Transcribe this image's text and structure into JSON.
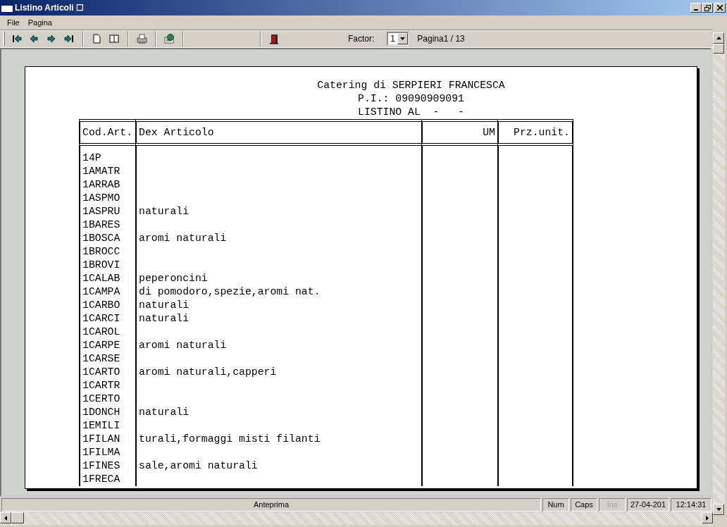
{
  "window": {
    "title": "Listino Articoli ☐"
  },
  "menu": [
    "File",
    "Pagina"
  ],
  "toolbar": {
    "buttons": [
      {
        "kind": "first"
      },
      {
        "kind": "prev"
      },
      {
        "kind": "next"
      },
      {
        "kind": "last"
      },
      {
        "kind": "sep"
      },
      {
        "kind": "page"
      },
      {
        "kind": "book"
      },
      {
        "kind": "sep"
      },
      {
        "kind": "print"
      },
      {
        "kind": "sep"
      },
      {
        "kind": "export"
      },
      {
        "kind": "sep"
      },
      {
        "kind": "spacer"
      },
      {
        "kind": "exit"
      }
    ],
    "factor_label": "Factor:",
    "factor_value": "1",
    "page_info": "Pagina1 / 13"
  },
  "report": {
    "header": [
      "Catering di SERPIERI FRANCESCA",
      "P.I.: 09090909091",
      "LISTINO AL  -   -"
    ],
    "columns": [
      "Cod.Art.",
      "Dex Articolo",
      "UM",
      "Prz.unit."
    ],
    "rows": [
      {
        "code": "14P",
        "desc": ""
      },
      {
        "code": "1AMATR",
        "desc": ""
      },
      {
        "code": "1ARRAB",
        "desc": ""
      },
      {
        "code": "1ASPMO",
        "desc": ""
      },
      {
        "code": "1ASPRU",
        "desc": "naturali"
      },
      {
        "code": "1BARES",
        "desc": ""
      },
      {
        "code": "1BOSCA",
        "desc": "aromi naturali"
      },
      {
        "code": "1BROCC",
        "desc": ""
      },
      {
        "code": "1BROVI",
        "desc": ""
      },
      {
        "code": "1CALAB",
        "desc": "peperoncini"
      },
      {
        "code": "1CAMPA",
        "desc": "di pomodoro,spezie,aromi nat."
      },
      {
        "code": "1CARBO",
        "desc": "naturali"
      },
      {
        "code": "1CARCI",
        "desc": "naturali"
      },
      {
        "code": "1CAROL",
        "desc": ""
      },
      {
        "code": "1CARPE",
        "desc": "aromi naturali"
      },
      {
        "code": "1CARSE",
        "desc": ""
      },
      {
        "code": "1CARTO",
        "desc": "aromi naturali,capperi"
      },
      {
        "code": "1CARTR",
        "desc": ""
      },
      {
        "code": "1CERTO",
        "desc": ""
      },
      {
        "code": "1DONCH",
        "desc": "naturali"
      },
      {
        "code": "1EMILI",
        "desc": ""
      },
      {
        "code": "1FILAN",
        "desc": "turali,formaggi misti filanti"
      },
      {
        "code": "1FILMA",
        "desc": ""
      },
      {
        "code": "1FINES",
        "desc": "sale,aromi naturali"
      },
      {
        "code": "1FRECA",
        "desc": ""
      }
    ]
  },
  "status_bar": [
    {
      "text": "Anteprima",
      "kind": "main",
      "disabled": false
    },
    {
      "text": "Num",
      "kind": "small",
      "disabled": false
    },
    {
      "text": "Caps",
      "kind": "small",
      "disabled": false
    },
    {
      "text": "Ins",
      "kind": "small",
      "disabled": true
    },
    {
      "text": "27-04-201",
      "kind": "small",
      "disabled": false
    },
    {
      "text": "12:14:31",
      "kind": "small",
      "disabled": false
    }
  ]
}
